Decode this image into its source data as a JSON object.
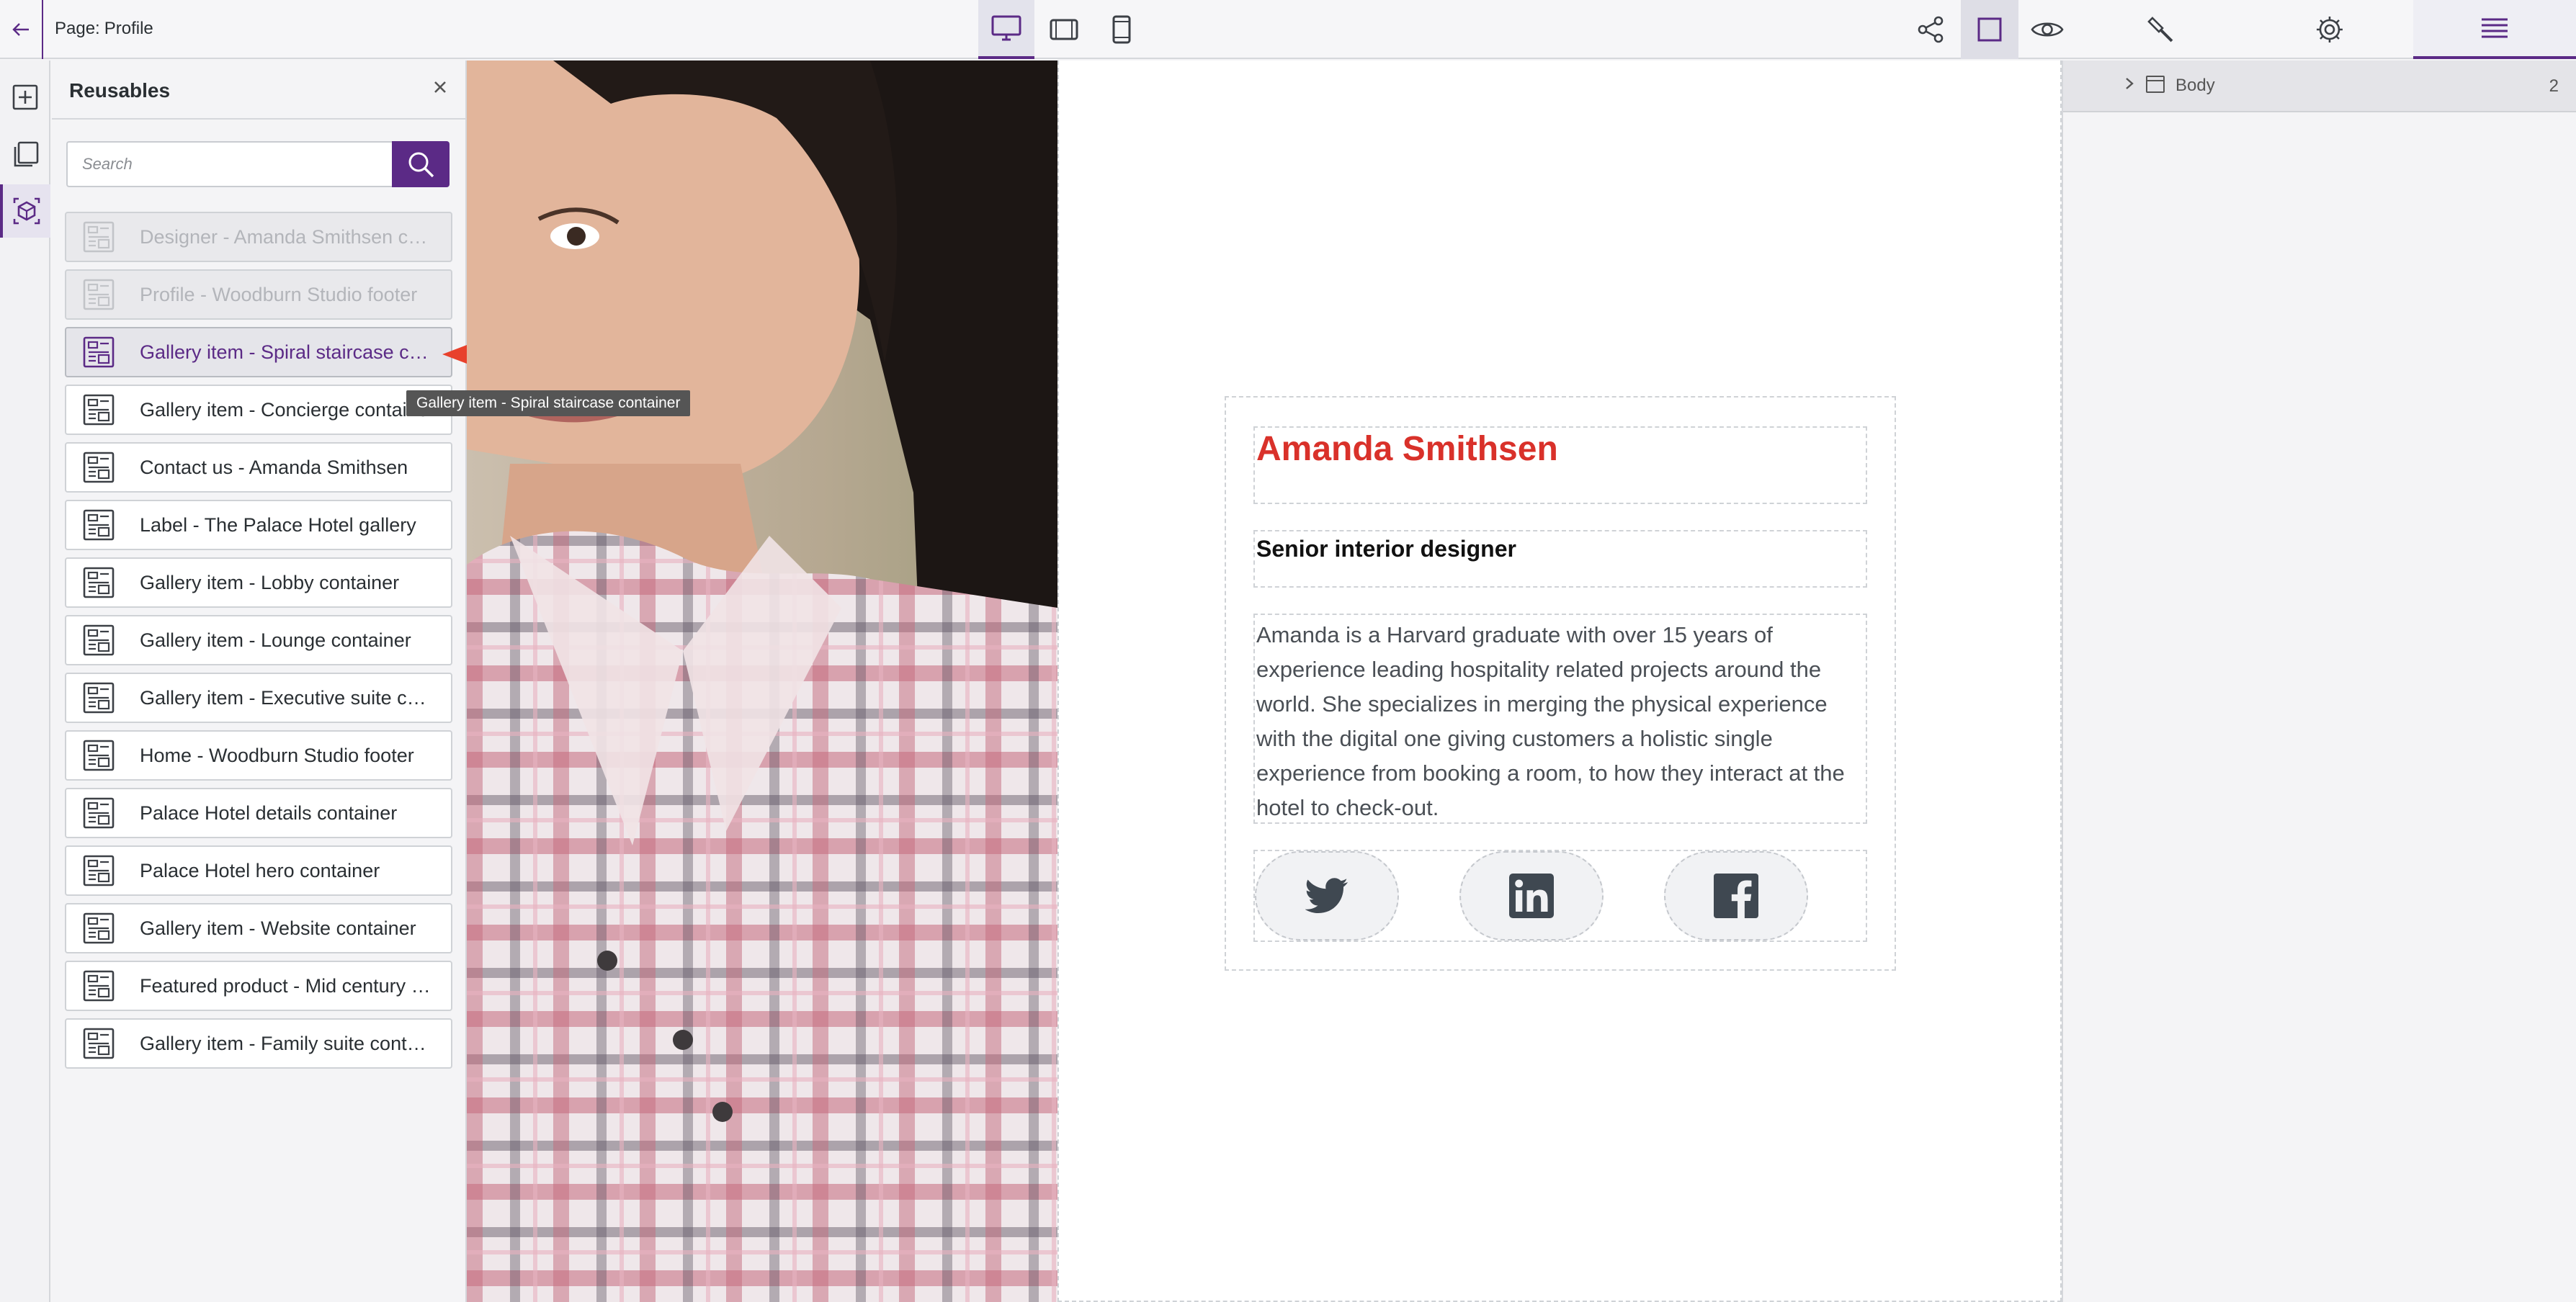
{
  "topbar": {
    "back_icon": "arrow-left-icon",
    "page_prefix": "Page:",
    "page_name": "Profile",
    "view_modes": [
      {
        "name": "desktop",
        "icon": "desktop-icon",
        "active": true
      },
      {
        "name": "tablet-landscape",
        "icon": "tablet-landscape-icon",
        "active": false
      },
      {
        "name": "tablet-portrait",
        "icon": "tablet-portrait-icon",
        "active": false
      }
    ],
    "tools": [
      "share-icon",
      "outline-toggle-icon",
      "preview-eye-icon"
    ],
    "right_tabs": [
      "style-brush-icon",
      "settings-gear-icon",
      "layers-list-icon"
    ]
  },
  "rail": {
    "items": [
      {
        "icon": "add-icon",
        "active": false
      },
      {
        "icon": "pages-icon",
        "active": false
      },
      {
        "icon": "reusables-icon",
        "active": true
      }
    ]
  },
  "reusables": {
    "title": "Reusables",
    "close_icon": "close-icon",
    "search_placeholder": "Search",
    "items": [
      {
        "label": "Designer - Amanda Smithsen container",
        "state": "disabled"
      },
      {
        "label": "Profile - Woodburn Studio footer",
        "state": "disabled"
      },
      {
        "label": "Gallery item - Spiral staircase container",
        "state": "selected"
      },
      {
        "label": "Gallery item - Concierge container",
        "state": "normal"
      },
      {
        "label": "Contact us - Amanda Smithsen",
        "state": "normal"
      },
      {
        "label": "Label - The Palace Hotel gallery",
        "state": "normal"
      },
      {
        "label": "Gallery item - Lobby container",
        "state": "normal"
      },
      {
        "label": "Gallery item - Lounge container",
        "state": "normal"
      },
      {
        "label": "Gallery item - Executive suite container",
        "state": "normal"
      },
      {
        "label": "Home - Woodburn Studio footer",
        "state": "normal"
      },
      {
        "label": "Palace Hotel details container",
        "state": "normal"
      },
      {
        "label": "Palace Hotel hero container",
        "state": "normal"
      },
      {
        "label": "Gallery item - Website container",
        "state": "normal"
      },
      {
        "label": "Featured product - Mid century chair",
        "state": "normal"
      },
      {
        "label": "Gallery item - Family suite container",
        "state": "normal"
      }
    ],
    "tooltip": "Gallery item - Spiral staircase container"
  },
  "profile": {
    "name": "Amanda Smithsen",
    "role": "Senior interior designer",
    "bio": "Amanda is a Harvard graduate with over 15 years of experience leading hospitality related projects around the world. She specializes in merging the physical experience with the digital one giving customers a holistic single experience from booking a room, to how they interact at the hotel to check-out.",
    "socials": [
      "twitter-icon",
      "linkedin-icon",
      "facebook-icon"
    ]
  },
  "layers": {
    "root_label": "Body",
    "root_count": "2"
  },
  "colors": {
    "accent": "#5b2a86",
    "name_red": "#d9312a",
    "annotation_arrow": "#e8412c"
  }
}
